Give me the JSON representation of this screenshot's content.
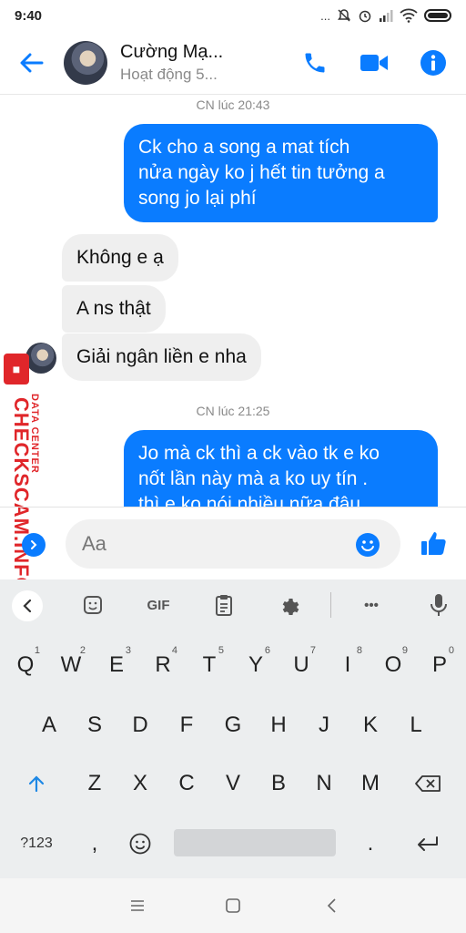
{
  "status_bar": {
    "time": "9:40",
    "dots": "..."
  },
  "header": {
    "contact_name": "Cường Mạ...",
    "presence": "Hoạt động 5..."
  },
  "chat": {
    "timestamp_1": "CN lúc 20:43",
    "msg_out_1": [
      "Ck cho a song a mat tích",
      "nửa ngày ko j hết tin tưởng a",
      "song jo lại phí"
    ],
    "msg_in_1": "Không e ạ",
    "msg_in_2": "A ns thật",
    "msg_in_3": "Giải ngân liền e nha",
    "timestamp_2": "CN lúc 21:25",
    "msg_out_2": [
      "Jo mà ck thì a ck vào tk e ko",
      "nốt lần này mà a ko uy tín .",
      "thì e ko nói nhiều nữa đâu"
    ]
  },
  "watermark": {
    "main": "CHECKSCAM.INFO",
    "sub": "DATA CENTER"
  },
  "composer": {
    "placeholder": "Aa"
  },
  "keyboard": {
    "toolbar": {
      "gif": "GIF",
      "more": "•••"
    },
    "row1": [
      "Q",
      "W",
      "E",
      "R",
      "T",
      "Y",
      "U",
      "I",
      "O",
      "P"
    ],
    "row1_hints": [
      "1",
      "2",
      "3",
      "4",
      "5",
      "6",
      "7",
      "8",
      "9",
      "0"
    ],
    "row2": [
      "A",
      "S",
      "D",
      "F",
      "G",
      "H",
      "J",
      "K",
      "L"
    ],
    "row3": [
      "Z",
      "X",
      "C",
      "V",
      "B",
      "N",
      "M"
    ],
    "row4": {
      "symbols": "?123",
      "comma": ",",
      "period": "."
    }
  },
  "colors": {
    "accent": "#0a7cff",
    "watermark": "#e0262a"
  },
  "icons": [
    "back-arrow-icon",
    "phone-icon",
    "video-icon",
    "info-icon",
    "plus-icon",
    "emoji-icon",
    "thumbs-up-icon",
    "sticker-icon",
    "clipboard-icon",
    "settings-icon",
    "microphone-icon",
    "shift-icon",
    "backspace-icon",
    "enter-icon"
  ]
}
